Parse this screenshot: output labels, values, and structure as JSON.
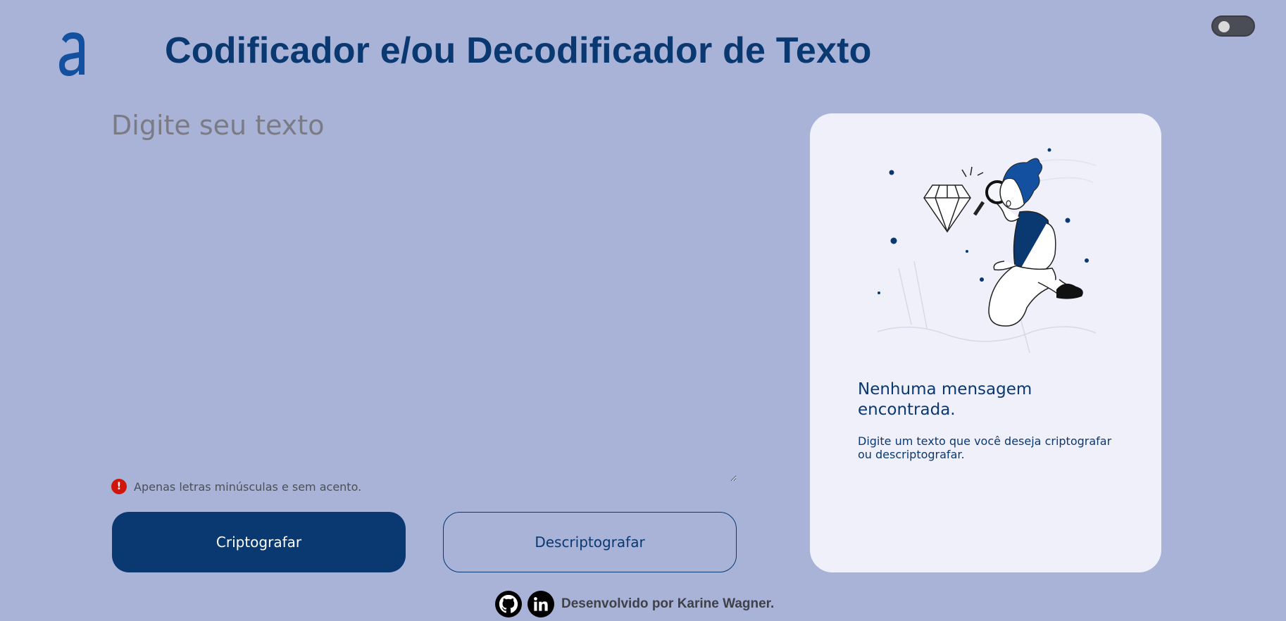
{
  "header": {
    "logo_icon": "alura-a-logo-icon",
    "title": "Codificador e/ou Decodificador de Texto",
    "theme_toggle_icon": "toggle-switch-icon"
  },
  "input": {
    "placeholder": "Digite seu texto",
    "value": ""
  },
  "hint": {
    "icon": "exclamation-circle-icon",
    "text": "Apenas letras minúsculas e sem acento."
  },
  "buttons": {
    "encrypt_label": "Criptografar",
    "decrypt_label": "Descriptografar"
  },
  "output": {
    "illustration": "person-magnifying-glass-diamond-illustration",
    "title": "Nenhuma mensagem encontrada.",
    "description": "Digite um texto que você deseja criptografar ou descriptografar."
  },
  "footer": {
    "github_icon": "github-icon",
    "linkedin_icon": "linkedin-icon",
    "credit": "Desenvolvido por Karine Wagner."
  },
  "colors": {
    "background": "#a9b2d7",
    "primary": "#0a3871",
    "card": "#eff0fa",
    "warning": "#d0160b"
  }
}
